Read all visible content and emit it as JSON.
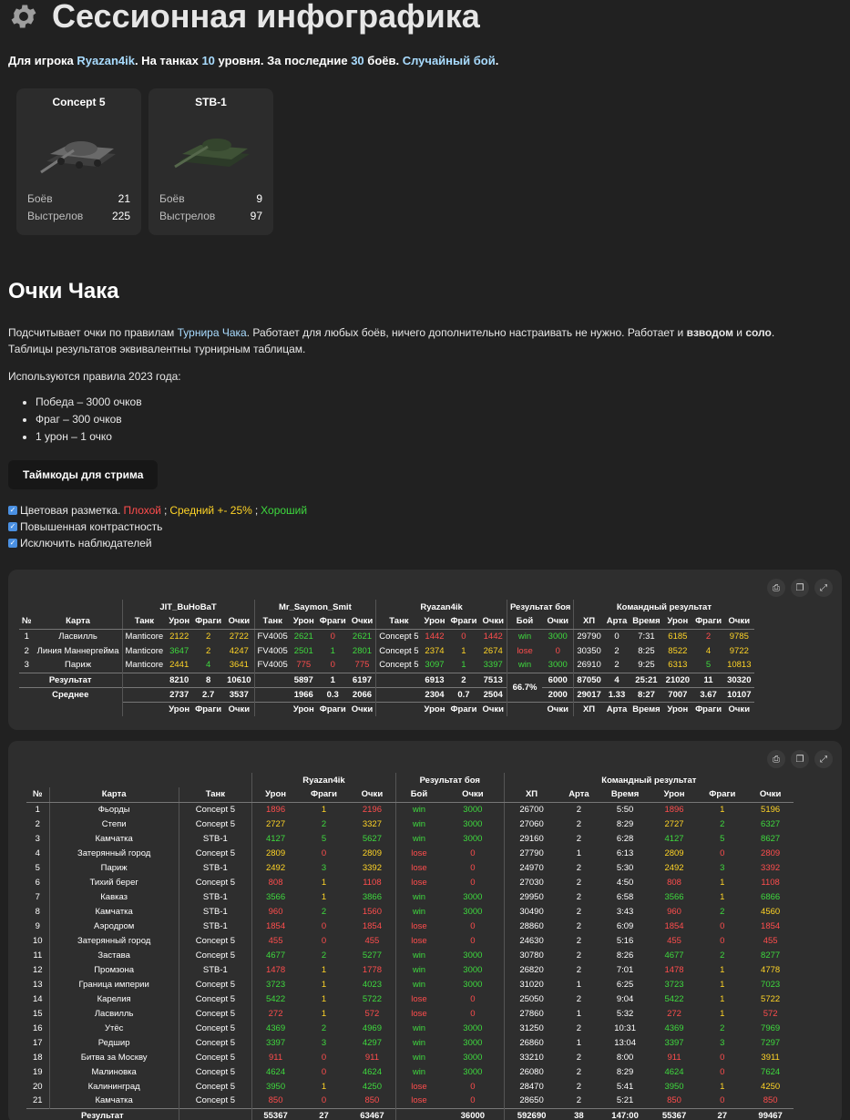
{
  "title": "Сессионная инфографика",
  "subtitle": {
    "p1": "Для игрока ",
    "player": "Ryazan4ik",
    "p2": ". На танках ",
    "level": "10",
    "p3": " уровня. За последние ",
    "count": "30",
    "p4": " боёв. ",
    "mode": "Случайный бой",
    "p5": "."
  },
  "tanks": [
    {
      "name": "Concept 5",
      "battles_label": "Боёв",
      "battles": "21",
      "shots_label": "Выстрелов",
      "shots": "225"
    },
    {
      "name": "STB-1",
      "battles_label": "Боёв",
      "battles": "9",
      "shots_label": "Выстрелов",
      "shots": "97"
    }
  ],
  "section_title": "Очки Чака",
  "desc": {
    "p1": "Подсчитывает очки по правилам ",
    "link": "Турнира Чака",
    "p2": ". Работает для любых боёв, ничего дополнительно настраивать не нужно. Работает и ",
    "b1": "взводом",
    "p3": " и ",
    "b2": "соло",
    "p4": ".",
    "line2": "Таблицы результатов эквивалентны турнирным таблицам."
  },
  "rules_title": "Используются правила 2023 года:",
  "rules": [
    "Победа – 3000 очков",
    "Фраг – 300 очков",
    "1 урон – 1 очко"
  ],
  "button": "Таймкоды для стрима",
  "options": {
    "color": "Цветовая разметка. ",
    "bad": "Плохой",
    "sep1": "; ",
    "mid": "Средний +- 25%",
    "sep2": "; ",
    "good": "Хороший",
    "contrast": "Повышенная контрастность",
    "exclude": "Исключить наблюдателей"
  },
  "colors": {
    "bad": "#ff4d4d",
    "mid": "#ffd426",
    "good": "#3ed93e"
  },
  "t1": {
    "players": [
      "JIT_BuHoBaT",
      "Mr_Saymon_Smit",
      "Ryazan4ik"
    ],
    "h_result": "Результат боя",
    "h_team": "Командный результат",
    "cols": {
      "no": "№",
      "map": "Карта",
      "tank": "Танк",
      "dmg": "Урон",
      "frags": "Фраги",
      "pts": "Очки",
      "battle": "Бой",
      "hp": "ХП",
      "arty": "Арта",
      "time": "Время"
    },
    "rows": [
      {
        "n": "1",
        "map": "Ласвилль",
        "p": [
          [
            "Manticore",
            "2122",
            "mid",
            "2",
            "mid",
            "2722",
            "mid"
          ],
          [
            "FV4005",
            "2621",
            "good",
            "0",
            "bad",
            "2621",
            "good"
          ],
          [
            "Concept 5",
            "1442",
            "bad",
            "0",
            "bad",
            "1442",
            "bad"
          ]
        ],
        "res": "win",
        "resc": "good",
        "rp": "3000",
        "rpc": "good",
        "hp": "29790",
        "arty": "0",
        "time": "7:31",
        "td": "6185",
        "tdc": "mid",
        "tf": "2",
        "tfc": "bad",
        "tp": "9785",
        "tpc": "mid"
      },
      {
        "n": "2",
        "map": "Линия Маннергейма",
        "p": [
          [
            "Manticore",
            "3647",
            "good",
            "2",
            "mid",
            "4247",
            "mid"
          ],
          [
            "FV4005",
            "2501",
            "good",
            "1",
            "good",
            "2801",
            "good"
          ],
          [
            "Concept 5",
            "2374",
            "mid",
            "1",
            "mid",
            "2674",
            "mid"
          ]
        ],
        "res": "lose",
        "resc": "bad",
        "rp": "0",
        "rpc": "bad",
        "hp": "30350",
        "arty": "2",
        "time": "8:25",
        "td": "8522",
        "tdc": "mid",
        "tf": "4",
        "tfc": "mid",
        "tp": "9722",
        "tpc": "mid"
      },
      {
        "n": "3",
        "map": "Париж",
        "p": [
          [
            "Manticore",
            "2441",
            "mid",
            "4",
            "good",
            "3641",
            "mid"
          ],
          [
            "FV4005",
            "775",
            "bad",
            "0",
            "bad",
            "775",
            "bad"
          ],
          [
            "Concept 5",
            "3097",
            "good",
            "1",
            "good",
            "3397",
            "good"
          ]
        ],
        "res": "win",
        "resc": "good",
        "rp": "3000",
        "rpc": "good",
        "hp": "26910",
        "arty": "2",
        "time": "9:25",
        "td": "6313",
        "tdc": "mid",
        "tf": "5",
        "tfc": "good",
        "tp": "10813",
        "tpc": "mid"
      }
    ],
    "total": {
      "label": "Результат",
      "p": [
        [
          "8210",
          "8",
          "10610"
        ],
        [
          "5897",
          "1",
          "6197"
        ],
        [
          "6913",
          "2",
          "7513"
        ]
      ],
      "winrate": "66.7%",
      "rp": "6000",
      "hp": "87050",
      "arty": "4",
      "time": "25:21",
      "td": "21020",
      "tf": "11",
      "tp": "30320"
    },
    "avg": {
      "label": "Среднее",
      "p": [
        [
          "2737",
          "2.7",
          "3537"
        ],
        [
          "1966",
          "0.3",
          "2066"
        ],
        [
          "2304",
          "0.7",
          "2504"
        ]
      ],
      "rp": "2000",
      "hp": "29017",
      "arty": "1.33",
      "time": "8:27",
      "td": "7007",
      "tf": "3.67",
      "tp": "10107"
    }
  },
  "t2": {
    "player": "Ryazan4ik",
    "h_result": "Результат боя",
    "h_team": "Командный результат",
    "rows": [
      [
        "1",
        "Фьорды",
        "Concept 5",
        "1896",
        "bad",
        "1",
        "mid",
        "2196",
        "bad",
        "win",
        "3000",
        "26700",
        "2",
        "5:50",
        "1896",
        "bad",
        "1",
        "mid",
        "5196",
        "mid"
      ],
      [
        "2",
        "Степи",
        "Concept 5",
        "2727",
        "mid",
        "2",
        "good",
        "3327",
        "mid",
        "win",
        "3000",
        "27060",
        "2",
        "8:29",
        "2727",
        "mid",
        "2",
        "good",
        "6327",
        "good"
      ],
      [
        "3",
        "Камчатка",
        "STB-1",
        "4127",
        "good",
        "5",
        "good",
        "5627",
        "good",
        "win",
        "3000",
        "29160",
        "2",
        "6:28",
        "4127",
        "good",
        "5",
        "good",
        "8627",
        "good"
      ],
      [
        "4",
        "Затерянный город",
        "Concept 5",
        "2809",
        "mid",
        "0",
        "bad",
        "2809",
        "mid",
        "lose",
        "0",
        "27790",
        "1",
        "6:13",
        "2809",
        "mid",
        "0",
        "bad",
        "2809",
        "bad"
      ],
      [
        "5",
        "Париж",
        "STB-1",
        "2492",
        "mid",
        "3",
        "good",
        "3392",
        "mid",
        "lose",
        "0",
        "24970",
        "2",
        "5:30",
        "2492",
        "mid",
        "3",
        "good",
        "3392",
        "bad"
      ],
      [
        "6",
        "Тихий берег",
        "Concept 5",
        "808",
        "bad",
        "1",
        "mid",
        "1108",
        "bad",
        "lose",
        "0",
        "27030",
        "2",
        "4:50",
        "808",
        "bad",
        "1",
        "mid",
        "1108",
        "bad"
      ],
      [
        "7",
        "Кавказ",
        "STB-1",
        "3566",
        "good",
        "1",
        "mid",
        "3866",
        "good",
        "win",
        "3000",
        "29950",
        "2",
        "6:58",
        "3566",
        "good",
        "1",
        "mid",
        "6866",
        "good"
      ],
      [
        "8",
        "Камчатка",
        "STB-1",
        "960",
        "bad",
        "2",
        "good",
        "1560",
        "bad",
        "win",
        "3000",
        "30490",
        "2",
        "3:43",
        "960",
        "bad",
        "2",
        "good",
        "4560",
        "mid"
      ],
      [
        "9",
        "Аэродром",
        "STB-1",
        "1854",
        "bad",
        "0",
        "bad",
        "1854",
        "bad",
        "lose",
        "0",
        "28860",
        "2",
        "6:09",
        "1854",
        "bad",
        "0",
        "bad",
        "1854",
        "bad"
      ],
      [
        "10",
        "Затерянный город",
        "Concept 5",
        "455",
        "bad",
        "0",
        "bad",
        "455",
        "bad",
        "lose",
        "0",
        "24630",
        "2",
        "5:16",
        "455",
        "bad",
        "0",
        "bad",
        "455",
        "bad"
      ],
      [
        "11",
        "Застава",
        "Concept 5",
        "4677",
        "good",
        "2",
        "good",
        "5277",
        "good",
        "win",
        "3000",
        "30780",
        "2",
        "8:26",
        "4677",
        "good",
        "2",
        "good",
        "8277",
        "good"
      ],
      [
        "12",
        "Промзона",
        "STB-1",
        "1478",
        "bad",
        "1",
        "mid",
        "1778",
        "bad",
        "win",
        "3000",
        "26820",
        "2",
        "7:01",
        "1478",
        "bad",
        "1",
        "mid",
        "4778",
        "mid"
      ],
      [
        "13",
        "Граница империи",
        "Concept 5",
        "3723",
        "good",
        "1",
        "mid",
        "4023",
        "good",
        "win",
        "3000",
        "31020",
        "1",
        "6:25",
        "3723",
        "good",
        "1",
        "mid",
        "7023",
        "good"
      ],
      [
        "14",
        "Карелия",
        "Concept 5",
        "5422",
        "good",
        "1",
        "mid",
        "5722",
        "good",
        "lose",
        "0",
        "25050",
        "2",
        "9:04",
        "5422",
        "good",
        "1",
        "mid",
        "5722",
        "mid"
      ],
      [
        "15",
        "Ласвилль",
        "Concept 5",
        "272",
        "bad",
        "1",
        "mid",
        "572",
        "bad",
        "lose",
        "0",
        "27860",
        "1",
        "5:32",
        "272",
        "bad",
        "1",
        "mid",
        "572",
        "bad"
      ],
      [
        "16",
        "Утёс",
        "Concept 5",
        "4369",
        "good",
        "2",
        "good",
        "4969",
        "good",
        "win",
        "3000",
        "31250",
        "2",
        "10:31",
        "4369",
        "good",
        "2",
        "good",
        "7969",
        "good"
      ],
      [
        "17",
        "Редшир",
        "Concept 5",
        "3397",
        "good",
        "3",
        "good",
        "4297",
        "good",
        "win",
        "3000",
        "26860",
        "1",
        "13:04",
        "3397",
        "good",
        "3",
        "good",
        "7297",
        "good"
      ],
      [
        "18",
        "Битва за Москву",
        "Concept 5",
        "911",
        "bad",
        "0",
        "bad",
        "911",
        "bad",
        "win",
        "3000",
        "33210",
        "2",
        "8:00",
        "911",
        "bad",
        "0",
        "bad",
        "3911",
        "mid"
      ],
      [
        "19",
        "Малиновка",
        "Concept 5",
        "4624",
        "good",
        "0",
        "bad",
        "4624",
        "good",
        "win",
        "3000",
        "26080",
        "2",
        "8:29",
        "4624",
        "good",
        "0",
        "bad",
        "7624",
        "good"
      ],
      [
        "20",
        "Калининград",
        "Concept 5",
        "3950",
        "good",
        "1",
        "mid",
        "4250",
        "good",
        "lose",
        "0",
        "28470",
        "2",
        "5:41",
        "3950",
        "good",
        "1",
        "mid",
        "4250",
        "mid"
      ],
      [
        "21",
        "Камчатка",
        "Concept 5",
        "850",
        "bad",
        "0",
        "bad",
        "850",
        "bad",
        "lose",
        "0",
        "28650",
        "2",
        "5:21",
        "850",
        "bad",
        "0",
        "bad",
        "850",
        "bad"
      ]
    ],
    "total": {
      "label": "Результат",
      "dmg": "55367",
      "frags": "27",
      "pts": "63467",
      "rp": "36000",
      "hp": "592690",
      "arty": "38",
      "time": "147:00",
      "td": "55367",
      "tf": "27",
      "tp": "99467"
    }
  }
}
